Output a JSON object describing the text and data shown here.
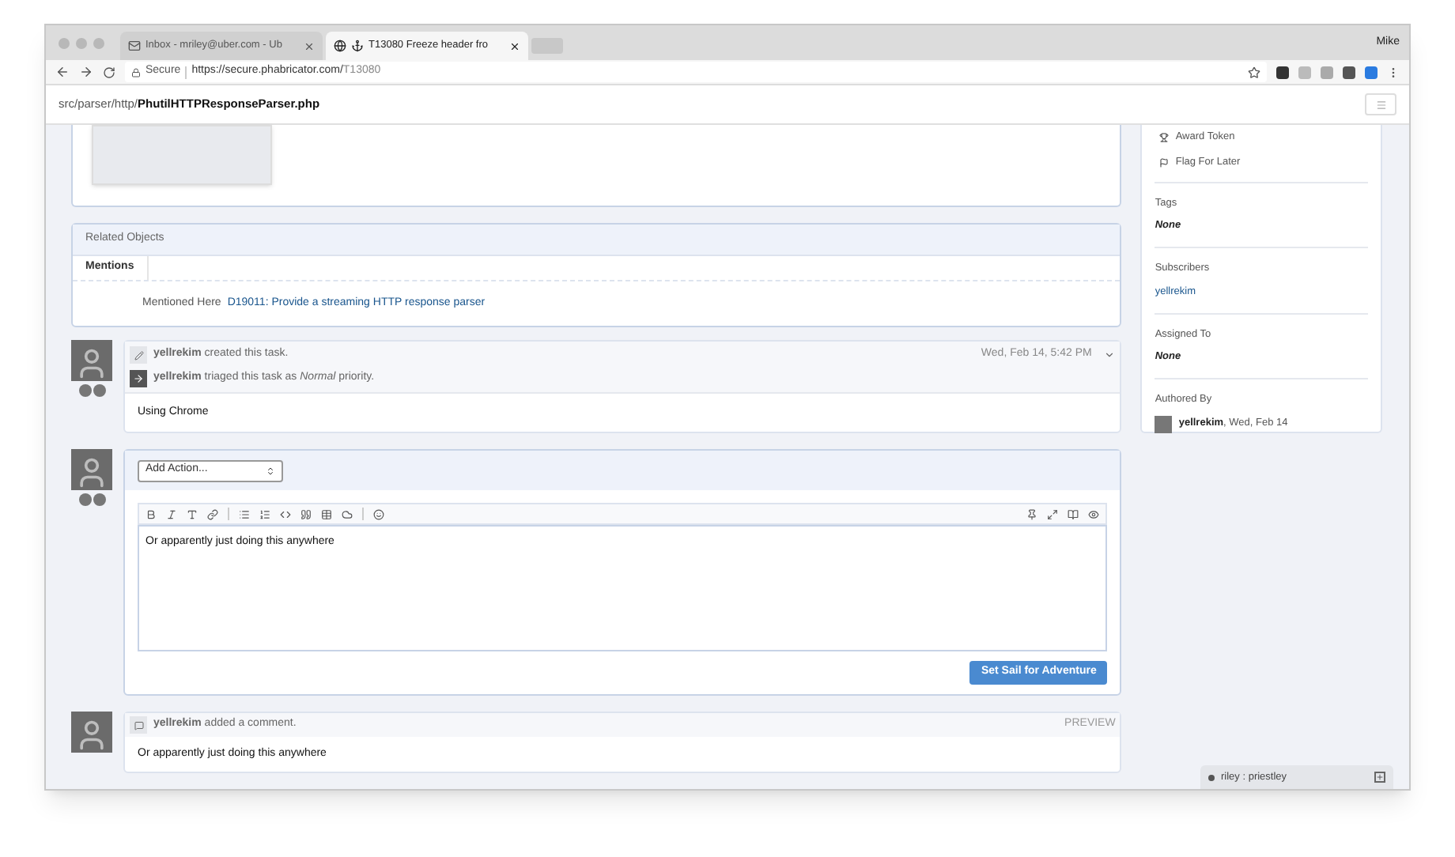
{
  "browser": {
    "tabs": [
      {
        "label": "Inbox - mriley@uber.com - Ub",
        "selected": false
      },
      {
        "label": "T13080 Freeze header fro",
        "selected": true
      }
    ],
    "profile": "Mike",
    "secure_label": "Secure",
    "url_host": "https://secure.phabricator.com/",
    "url_path": "T13080"
  },
  "header": {
    "path": "src/parser/http/",
    "file": "PhutilHTTPResponseParser.php"
  },
  "related": {
    "title": "Related Objects",
    "tab": "Mentions",
    "row_label": "Mentioned Here",
    "row_link": "D19011: Provide a streaming HTTP response parser"
  },
  "events": [
    {
      "kind": "create",
      "text": "**yellrekim** created this task.",
      "time": "Wed, Feb 14, 5:42 PM"
    },
    {
      "kind": "triage",
      "text": "**yellrekim** triaged this task as *Normal* priority."
    }
  ],
  "event_body": "Using Chrome",
  "form": {
    "action": "Add Action...",
    "text": "Or apparently just doing this anywhere",
    "submit": "Set Sail for Adventure"
  },
  "preview": {
    "text": "**yellrekim** added a comment.",
    "tag": "PREVIEW",
    "body": "Or apparently just doing this anywhere"
  },
  "sidebar": {
    "actions": [
      {
        "kind": "trophy",
        "label": "Award Token"
      },
      {
        "kind": "flag",
        "label": "Flag For Later"
      }
    ],
    "fields": [
      {
        "label": "Tags",
        "value": "None",
        "kind": "none"
      },
      {
        "label": "Subscribers",
        "value": "yellrekim",
        "kind": "link"
      },
      {
        "label": "Assigned To",
        "value": "None",
        "kind": "none"
      }
    ],
    "authored_label": "Authored By",
    "author": "yellrekim",
    "authored_date": ", Wed, Feb 14"
  },
  "chat": {
    "label": "riley : priestley"
  }
}
